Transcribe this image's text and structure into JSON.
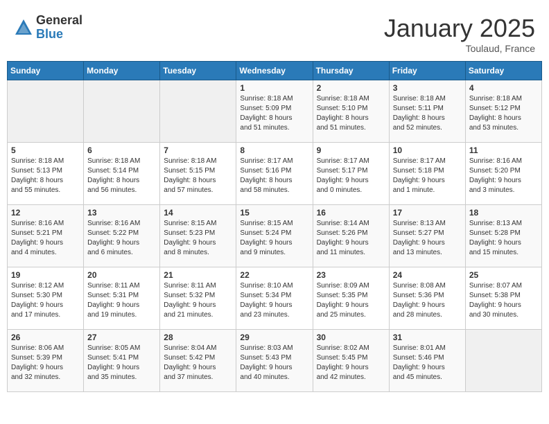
{
  "header": {
    "logo_general": "General",
    "logo_blue": "Blue",
    "month_year": "January 2025",
    "location": "Toulaud, France"
  },
  "weekdays": [
    "Sunday",
    "Monday",
    "Tuesday",
    "Wednesday",
    "Thursday",
    "Friday",
    "Saturday"
  ],
  "weeks": [
    [
      {
        "day": "",
        "info": ""
      },
      {
        "day": "",
        "info": ""
      },
      {
        "day": "",
        "info": ""
      },
      {
        "day": "1",
        "info": "Sunrise: 8:18 AM\nSunset: 5:09 PM\nDaylight: 8 hours\nand 51 minutes."
      },
      {
        "day": "2",
        "info": "Sunrise: 8:18 AM\nSunset: 5:10 PM\nDaylight: 8 hours\nand 51 minutes."
      },
      {
        "day": "3",
        "info": "Sunrise: 8:18 AM\nSunset: 5:11 PM\nDaylight: 8 hours\nand 52 minutes."
      },
      {
        "day": "4",
        "info": "Sunrise: 8:18 AM\nSunset: 5:12 PM\nDaylight: 8 hours\nand 53 minutes."
      }
    ],
    [
      {
        "day": "5",
        "info": "Sunrise: 8:18 AM\nSunset: 5:13 PM\nDaylight: 8 hours\nand 55 minutes."
      },
      {
        "day": "6",
        "info": "Sunrise: 8:18 AM\nSunset: 5:14 PM\nDaylight: 8 hours\nand 56 minutes."
      },
      {
        "day": "7",
        "info": "Sunrise: 8:18 AM\nSunset: 5:15 PM\nDaylight: 8 hours\nand 57 minutes."
      },
      {
        "day": "8",
        "info": "Sunrise: 8:17 AM\nSunset: 5:16 PM\nDaylight: 8 hours\nand 58 minutes."
      },
      {
        "day": "9",
        "info": "Sunrise: 8:17 AM\nSunset: 5:17 PM\nDaylight: 9 hours\nand 0 minutes."
      },
      {
        "day": "10",
        "info": "Sunrise: 8:17 AM\nSunset: 5:18 PM\nDaylight: 9 hours\nand 1 minute."
      },
      {
        "day": "11",
        "info": "Sunrise: 8:16 AM\nSunset: 5:20 PM\nDaylight: 9 hours\nand 3 minutes."
      }
    ],
    [
      {
        "day": "12",
        "info": "Sunrise: 8:16 AM\nSunset: 5:21 PM\nDaylight: 9 hours\nand 4 minutes."
      },
      {
        "day": "13",
        "info": "Sunrise: 8:16 AM\nSunset: 5:22 PM\nDaylight: 9 hours\nand 6 minutes."
      },
      {
        "day": "14",
        "info": "Sunrise: 8:15 AM\nSunset: 5:23 PM\nDaylight: 9 hours\nand 8 minutes."
      },
      {
        "day": "15",
        "info": "Sunrise: 8:15 AM\nSunset: 5:24 PM\nDaylight: 9 hours\nand 9 minutes."
      },
      {
        "day": "16",
        "info": "Sunrise: 8:14 AM\nSunset: 5:26 PM\nDaylight: 9 hours\nand 11 minutes."
      },
      {
        "day": "17",
        "info": "Sunrise: 8:13 AM\nSunset: 5:27 PM\nDaylight: 9 hours\nand 13 minutes."
      },
      {
        "day": "18",
        "info": "Sunrise: 8:13 AM\nSunset: 5:28 PM\nDaylight: 9 hours\nand 15 minutes."
      }
    ],
    [
      {
        "day": "19",
        "info": "Sunrise: 8:12 AM\nSunset: 5:30 PM\nDaylight: 9 hours\nand 17 minutes."
      },
      {
        "day": "20",
        "info": "Sunrise: 8:11 AM\nSunset: 5:31 PM\nDaylight: 9 hours\nand 19 minutes."
      },
      {
        "day": "21",
        "info": "Sunrise: 8:11 AM\nSunset: 5:32 PM\nDaylight: 9 hours\nand 21 minutes."
      },
      {
        "day": "22",
        "info": "Sunrise: 8:10 AM\nSunset: 5:34 PM\nDaylight: 9 hours\nand 23 minutes."
      },
      {
        "day": "23",
        "info": "Sunrise: 8:09 AM\nSunset: 5:35 PM\nDaylight: 9 hours\nand 25 minutes."
      },
      {
        "day": "24",
        "info": "Sunrise: 8:08 AM\nSunset: 5:36 PM\nDaylight: 9 hours\nand 28 minutes."
      },
      {
        "day": "25",
        "info": "Sunrise: 8:07 AM\nSunset: 5:38 PM\nDaylight: 9 hours\nand 30 minutes."
      }
    ],
    [
      {
        "day": "26",
        "info": "Sunrise: 8:06 AM\nSunset: 5:39 PM\nDaylight: 9 hours\nand 32 minutes."
      },
      {
        "day": "27",
        "info": "Sunrise: 8:05 AM\nSunset: 5:41 PM\nDaylight: 9 hours\nand 35 minutes."
      },
      {
        "day": "28",
        "info": "Sunrise: 8:04 AM\nSunset: 5:42 PM\nDaylight: 9 hours\nand 37 minutes."
      },
      {
        "day": "29",
        "info": "Sunrise: 8:03 AM\nSunset: 5:43 PM\nDaylight: 9 hours\nand 40 minutes."
      },
      {
        "day": "30",
        "info": "Sunrise: 8:02 AM\nSunset: 5:45 PM\nDaylight: 9 hours\nand 42 minutes."
      },
      {
        "day": "31",
        "info": "Sunrise: 8:01 AM\nSunset: 5:46 PM\nDaylight: 9 hours\nand 45 minutes."
      },
      {
        "day": "",
        "info": ""
      }
    ]
  ]
}
